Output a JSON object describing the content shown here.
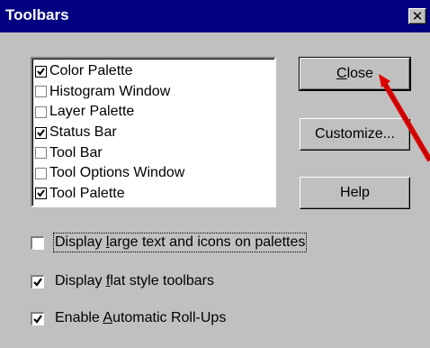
{
  "window": {
    "title": "Toolbars"
  },
  "palettes": [
    {
      "label": "Color Palette",
      "checked": true
    },
    {
      "label": "Histogram Window",
      "checked": false
    },
    {
      "label": "Layer Palette",
      "checked": false
    },
    {
      "label": "Status Bar",
      "checked": true
    },
    {
      "label": "Tool Bar",
      "checked": false
    },
    {
      "label": "Tool Options Window",
      "checked": false
    },
    {
      "label": "Tool Palette",
      "checked": true
    }
  ],
  "buttons": {
    "close": {
      "pre": "",
      "accel": "C",
      "post": "lose"
    },
    "customize": "Customize...",
    "help": "Help"
  },
  "options": [
    {
      "pre": "Display ",
      "accel": "l",
      "post": "arge text and icons on palettes",
      "checked": false
    },
    {
      "pre": "Display ",
      "accel": "f",
      "post": "lat style toolbars",
      "checked": true
    },
    {
      "pre": "Enable ",
      "accel": "A",
      "post": "utomatic Roll-Ups",
      "checked": true
    }
  ],
  "colors": {
    "titlebar": "#000080",
    "face": "#c0c0c0",
    "annotation_arrow": "#e00000"
  }
}
